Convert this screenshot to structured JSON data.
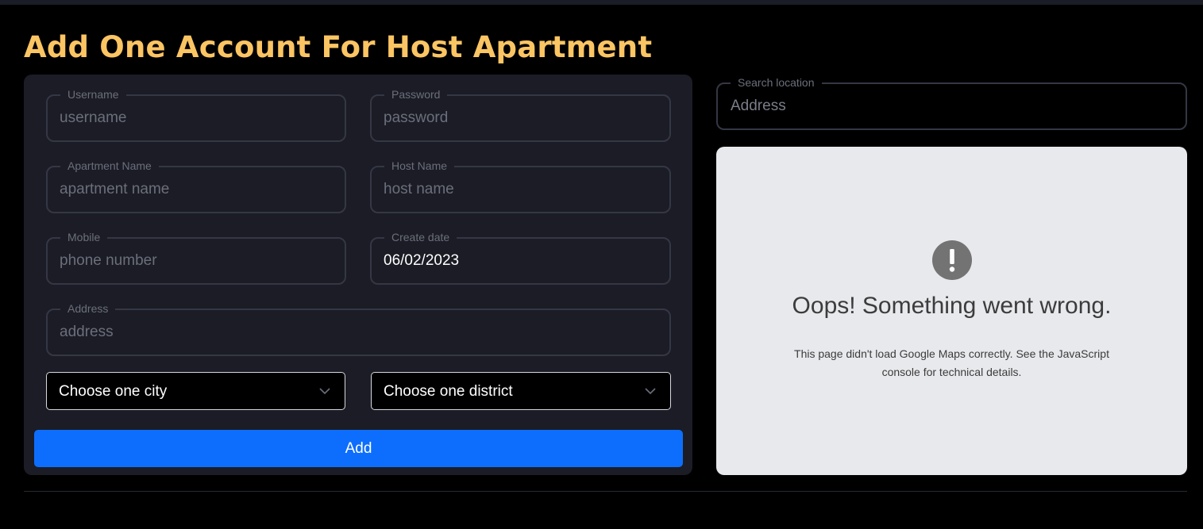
{
  "header": {
    "title": "Add One Account For Host Apartment"
  },
  "form": {
    "username": {
      "legend": "Username",
      "placeholder": "username"
    },
    "password": {
      "legend": "Password",
      "placeholder": "password"
    },
    "apartment_name": {
      "legend": "Apartment Name",
      "placeholder": "apartment name"
    },
    "host_name": {
      "legend": "Host Name",
      "placeholder": "host name"
    },
    "mobile": {
      "legend": "Mobile",
      "placeholder": "phone number"
    },
    "create_date": {
      "legend": "Create date",
      "value": "06/02/2023"
    },
    "address": {
      "legend": "Address",
      "placeholder": "address"
    },
    "city_select": {
      "selected": "Choose one city"
    },
    "district_select": {
      "selected": "Choose one district"
    },
    "add_label": "Add"
  },
  "search": {
    "legend": "Search location",
    "placeholder": "Address"
  },
  "map_error": {
    "title": "Oops! Something went wrong.",
    "message": "This page didn't load Google Maps correctly. See the JavaScript console for technical details."
  },
  "icons": {
    "select_chevron": "chevron-down-icon",
    "map_warning": "exclamation-icon"
  },
  "colors": {
    "title": "#fcc563",
    "card": "#1b1c25",
    "button": "#0d6efd",
    "map_bg": "#e8e9ec"
  }
}
